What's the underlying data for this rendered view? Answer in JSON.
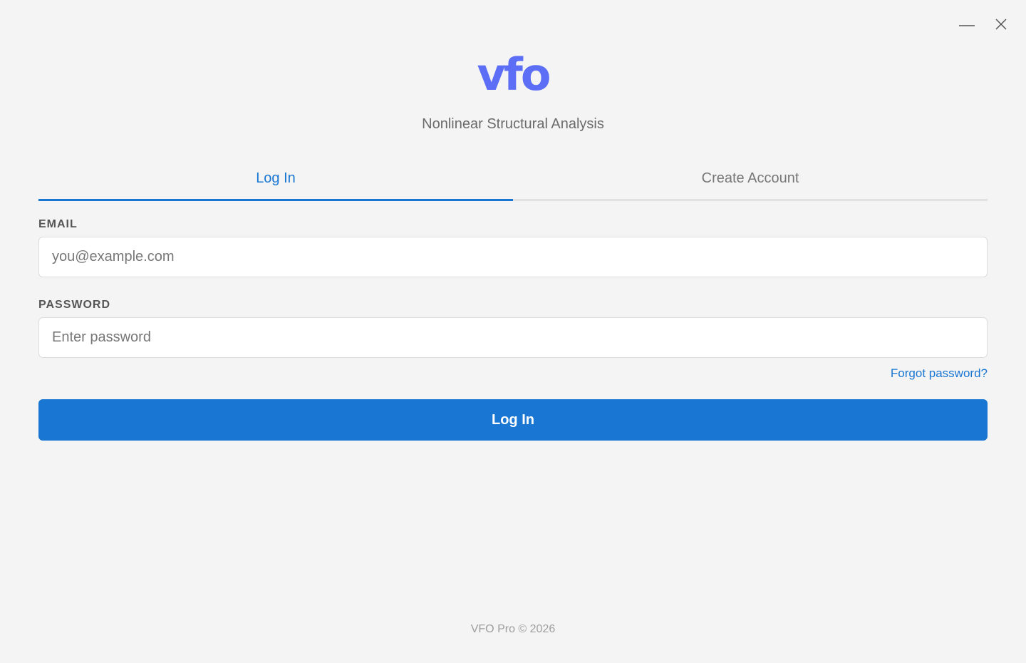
{
  "window": {
    "minimize_icon": "minimize-icon",
    "close_icon": "close-icon"
  },
  "brand": {
    "logo_text": "vfo",
    "logo_color": "#5b6ef5",
    "subtitle": "Nonlinear Structural Analysis"
  },
  "tabs": [
    {
      "label": "Log In",
      "active": true
    },
    {
      "label": "Create Account",
      "active": false
    }
  ],
  "form": {
    "email": {
      "label": "EMAIL",
      "placeholder": "you@example.com",
      "value": ""
    },
    "password": {
      "label": "PASSWORD",
      "placeholder": "Enter password",
      "value": ""
    },
    "forgot_link": "Forgot password?",
    "submit_label": "Log In"
  },
  "footer": {
    "text": "VFO Pro © 2026"
  },
  "colors": {
    "accent": "#1976d2",
    "background": "#f4f4f4",
    "logo": "#5b6ef5"
  }
}
